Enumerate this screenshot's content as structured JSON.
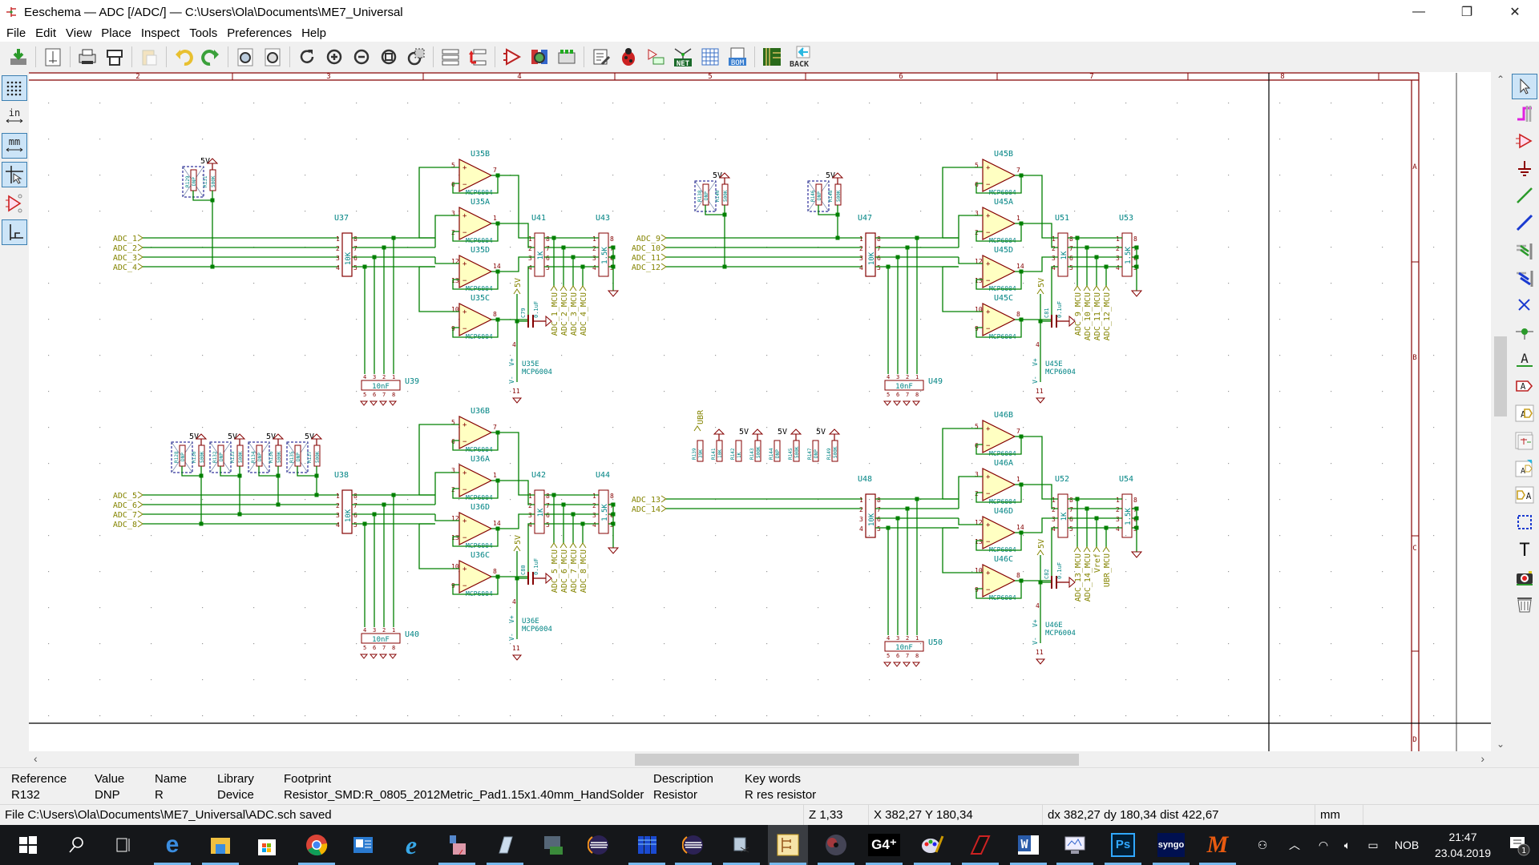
{
  "window": {
    "title": "Eeschema — ADC [/ADC/] — C:\\Users\\Ola\\Documents\\ME7_Universal",
    "controls": {
      "minimize": "—",
      "restore": "❐",
      "close": "✕"
    }
  },
  "menubar": [
    "File",
    "Edit",
    "View",
    "Place",
    "Inspect",
    "Tools",
    "Preferences",
    "Help"
  ],
  "toolbar": {
    "items": [
      "save-icon",
      "page-settings-icon",
      "print-icon",
      "plot-icon",
      "paste-icon",
      "undo-icon",
      "redo-icon",
      "find-icon",
      "find-replace-icon",
      "redraw-icon",
      "zoom-in-icon",
      "zoom-out-icon",
      "zoom-fit-icon",
      "zoom-selection-icon",
      "hierarchy-navigator-icon",
      "leave-sheet-icon",
      "symbol-editor-icon",
      "symbol-browser-icon",
      "footprint-assign-icon",
      "annotate-icon",
      "erc-icon",
      "footprint-editor-icon",
      "netlist-icon",
      "bus-definitions-icon",
      "bom-icon",
      "pcbnew-icon",
      "back-annotate-icon"
    ],
    "netlist_label": "NET",
    "bom_label": "BOM",
    "back_label": "BACK"
  },
  "left_toolbar": {
    "items": [
      "grid-toggle",
      "inch-units",
      "mm-units",
      "cursor-full",
      "hidden-pins",
      "wire-45-mode"
    ],
    "in_label": "in",
    "mm_label": "mm"
  },
  "right_toolbar": {
    "items": [
      "select-tool",
      "highlight-net",
      "add-symbol",
      "add-power",
      "add-wire",
      "add-bus",
      "wire-bus-entry",
      "bus-bus-entry",
      "no-connect",
      "junction",
      "net-label",
      "global-label",
      "hierarchical-label",
      "hierarchical-sheet",
      "import-sheet-pin",
      "sheet-pin",
      "graphic-line",
      "text",
      "image",
      "delete"
    ],
    "text_glyph": "T"
  },
  "sheet": {
    "column_labels": [
      "2",
      "3",
      "4",
      "5",
      "6",
      "7",
      "8"
    ],
    "row_labels": [
      "A",
      "B",
      "C",
      "D"
    ]
  },
  "schematic": {
    "blocks": [
      {
        "inputs": [
          "ADC_1",
          "ADC_2",
          "ADC_3",
          "ADC_4"
        ],
        "outputs": [
          "ADC_1_MCU",
          "ADC_2_MCU",
          "ADC_3_MCU",
          "ADC_4_MCU"
        ],
        "rnet_in": {
          "ref": "U37",
          "value": "10K"
        },
        "cap_net": {
          "ref": "U39",
          "value": "10nF"
        },
        "rnet_mid": {
          "ref": "U41",
          "value": "1K"
        },
        "rnet_out": {
          "ref": "U43",
          "value": "1.5K"
        },
        "opamps": [
          "U35B",
          "U35A",
          "U35D",
          "U35C"
        ],
        "opamp_pins": [
          [
            "5",
            "6",
            "7"
          ],
          [
            "3",
            "2",
            "1"
          ],
          [
            "12",
            "13",
            "14"
          ],
          [
            "10",
            "9",
            "8"
          ]
        ],
        "opamp_value": "MCP6004",
        "power_unit": "U35E",
        "decoupling": {
          "ref": "C79",
          "value": "0.1uF"
        },
        "pullups": [
          {
            "refs": [
              "R129",
              "R131"
            ],
            "values": [
              "DNP",
              "500K"
            ],
            "rail": "5V"
          }
        ]
      },
      {
        "inputs": [
          "ADC_9",
          "ADC_10",
          "ADC_11",
          "ADC_12"
        ],
        "outputs": [
          "ADC_9_MCU",
          "ADC_10_MCU",
          "ADC_11_MCU",
          "ADC_12_MCU"
        ],
        "rnet_in": {
          "ref": "U47",
          "value": "10K"
        },
        "cap_net": {
          "ref": "U49",
          "value": "10nF"
        },
        "rnet_mid": {
          "ref": "U51",
          "value": "1K"
        },
        "rnet_out": {
          "ref": "U53",
          "value": "1.5K"
        },
        "opamps": [
          "U45B",
          "U45A",
          "U45D",
          "U45C"
        ],
        "opamp_pins": [
          [
            "5",
            "6",
            "7"
          ],
          [
            "3",
            "2",
            "1"
          ],
          [
            "12",
            "13",
            "14"
          ],
          [
            "10",
            "9",
            "8"
          ]
        ],
        "opamp_value": "MCP6004",
        "power_unit": "U45E",
        "decoupling": {
          "ref": "C81",
          "value": "0.1uF"
        },
        "pullups": [
          {
            "refs": [
              "R138",
              "R140"
            ],
            "values": [
              "DNP",
              "500K"
            ],
            "rail": "5V"
          },
          {
            "refs": [
              "R146",
              "R148"
            ],
            "values": [
              "DNP",
              "500K"
            ],
            "rail": "5V"
          }
        ]
      },
      {
        "inputs": [
          "ADC_5",
          "ADC_6",
          "ADC_7",
          "ADC_8"
        ],
        "outputs": [
          "ADC_5_MCU",
          "ADC_6_MCU",
          "ADC_7_MCU",
          "ADC_8_MCU"
        ],
        "rnet_in": {
          "ref": "U38",
          "value": "10K"
        },
        "cap_net": {
          "ref": "U40",
          "value": "10nF"
        },
        "rnet_mid": {
          "ref": "U42",
          "value": "1K"
        },
        "rnet_out": {
          "ref": "U44",
          "value": "1.5K"
        },
        "opamps": [
          "U36B",
          "U36A",
          "U36D",
          "U36C"
        ],
        "opamp_pins": [
          [
            "5",
            "6",
            "7"
          ],
          [
            "3",
            "2",
            "1"
          ],
          [
            "12",
            "13",
            "14"
          ],
          [
            "10",
            "9",
            "8"
          ]
        ],
        "opamp_value": "MCP6004",
        "power_unit": "U36E",
        "decoupling": {
          "ref": "C80",
          "value": "0.1uF"
        },
        "pullups": [
          {
            "refs": [
              "R128",
              "R130"
            ],
            "values": [
              "DNP",
              "500K"
            ],
            "rail": "5V"
          },
          {
            "refs": [
              "R132",
              "R133"
            ],
            "values": [
              "DNP",
              "500K"
            ],
            "rail": "5V"
          },
          {
            "refs": [
              "R134",
              "R136"
            ],
            "values": [
              "DNP",
              "500K"
            ],
            "rail": "5V"
          },
          {
            "refs": [
              "R135",
              "R137"
            ],
            "values": [
              "DNP",
              "500K"
            ],
            "rail": "5V"
          }
        ]
      },
      {
        "inputs": [
          "ADC_13",
          "ADC_14"
        ],
        "outputs": [
          "ADC_13_MCU",
          "ADC_14_MCU",
          "Vref",
          "UBR_MCU"
        ],
        "rnet_in": {
          "ref": "U48",
          "value": "10K"
        },
        "cap_net": {
          "ref": "U50",
          "value": "10nF"
        },
        "rnet_mid": {
          "ref": "U52",
          "value": "1K"
        },
        "rnet_out": {
          "ref": "U54",
          "value": "1.5K"
        },
        "opamps": [
          "U46B",
          "U46A",
          "U46D",
          "U46C"
        ],
        "opamp_pins": [
          [
            "5",
            "6",
            "7"
          ],
          [
            "3",
            "2",
            "1"
          ],
          [
            "12",
            "13",
            "14"
          ],
          [
            "10",
            "9",
            "8"
          ]
        ],
        "opamp_value": "MCP6004",
        "power_unit": "U46E",
        "decoupling": {
          "ref": "C82",
          "value": "0.1uF"
        },
        "ubr_label": "UBR",
        "resistors": [
          {
            "ref": "R139",
            "value": "39K"
          },
          {
            "ref": "R141",
            "value": "10K"
          },
          {
            "ref": "R142",
            "value": "1K"
          },
          {
            "ref": "R143",
            "value": "500K"
          },
          {
            "ref": "R144",
            "value": "DNP"
          },
          {
            "ref": "R145",
            "value": "500K"
          },
          {
            "ref": "R147",
            "value": "DNP"
          },
          {
            "ref": "R149",
            "value": "500K"
          }
        ],
        "rail": "5V"
      }
    ],
    "vplus": "V+",
    "vminus": "V-",
    "pin4": "4",
    "pin11": "11",
    "rail_5v": "5V"
  },
  "info_panel": {
    "columns": [
      {
        "header": "Reference",
        "value": "R132"
      },
      {
        "header": "Value",
        "value": "DNP"
      },
      {
        "header": "Name",
        "value": "R"
      },
      {
        "header": "Library",
        "value": "Device"
      },
      {
        "header": "Footprint",
        "value": "Resistor_SMD:R_0805_2012Metric_Pad1.15x1.40mm_HandSolder"
      },
      {
        "header": "Description",
        "value": "Resistor"
      },
      {
        "header": "Key words",
        "value": "R res resistor"
      }
    ]
  },
  "statusbar": {
    "message": "File C:\\Users\\Ola\\Documents\\ME7_Universal\\ADC.sch saved",
    "zoom": "Z 1,33",
    "coords": "X 382,27  Y 180,34",
    "delta": "dx 382,27  dy 180,34  dist 422,67",
    "units": "mm"
  },
  "taskbar": {
    "apps": [
      "start",
      "search",
      "task-view",
      "edge",
      "file-explorer",
      "store",
      "chrome",
      "outlook-style",
      "internet-explorer",
      "app-tool",
      "notepad-tool",
      "device-manager",
      "eclipse",
      "server-app",
      "eclipse-2",
      "snipping",
      "eeschema",
      "disc-app",
      "g4",
      "paint",
      "autocad",
      "word",
      "monitor",
      "photoshop",
      "syngo",
      "matlab-m"
    ],
    "g4_label": "G4⁺",
    "ps_label": "Ps",
    "syngo_label": "syngo",
    "word_label": "W",
    "m_label": "M",
    "tray": {
      "language": "NOB",
      "time": "21:47",
      "date": "23.04.2019",
      "notifications": "1"
    }
  },
  "colors": {
    "wire": "#008000",
    "symbol_body": "#840000",
    "symbol_fill": "#ffffc2",
    "ref_text": "#008484",
    "label_text": "#848400",
    "sheet_border": "#840000",
    "dnp_box": "#000084"
  }
}
